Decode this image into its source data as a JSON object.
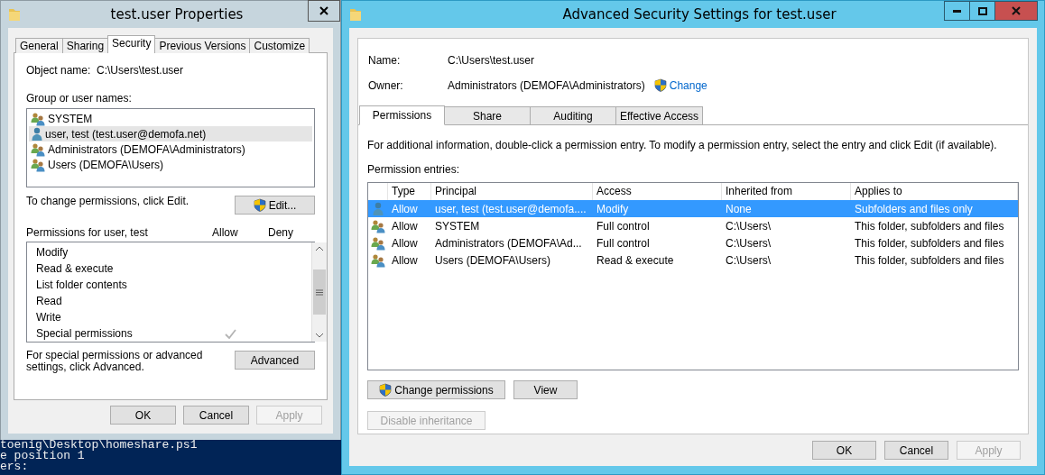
{
  "properties_window": {
    "title": "test.user Properties",
    "tabs": [
      {
        "label": "General",
        "selected": false
      },
      {
        "label": "Sharing",
        "selected": false
      },
      {
        "label": "Security",
        "selected": true
      },
      {
        "label": "Previous Versions",
        "selected": false
      },
      {
        "label": "Customize",
        "selected": false
      }
    ],
    "object_name_label": "Object name:",
    "object_name_value": "C:\\Users\\test.user",
    "groups_label": "Group or user names:",
    "groups": [
      {
        "kind": "group",
        "name": "SYSTEM",
        "selected": false
      },
      {
        "kind": "user",
        "name": "user, test (test.user@demofa.net)",
        "selected": true
      },
      {
        "kind": "group",
        "name": "Administrators (DEMOFA\\Administrators)",
        "selected": false
      },
      {
        "kind": "group",
        "name": "Users (DEMOFA\\Users)",
        "selected": false
      }
    ],
    "edit_hint": "To change permissions, click Edit.",
    "edit_button": "Edit...",
    "permissions_label": "Permissions for user, test",
    "allow_header": "Allow",
    "deny_header": "Deny",
    "permissions": [
      {
        "name": "Modify",
        "allow": false
      },
      {
        "name": "Read & execute",
        "allow": false
      },
      {
        "name": "List folder contents",
        "allow": false
      },
      {
        "name": "Read",
        "allow": false
      },
      {
        "name": "Write",
        "allow": false
      },
      {
        "name": "Special permissions",
        "allow": true
      }
    ],
    "advanced_hint": "For special permissions or advanced settings, click Advanced.",
    "advanced_button": "Advanced",
    "buttons": [
      {
        "label": "OK",
        "disabled": false
      },
      {
        "label": "Cancel",
        "disabled": false
      },
      {
        "label": "Apply",
        "disabled": true
      }
    ]
  },
  "console": {
    "lines": [
      "toenig\\Desktop\\homeshare.ps1",
      "e position 1",
      "ers:"
    ]
  },
  "advanced_window": {
    "title": "Advanced Security Settings for test.user",
    "name_label": "Name:",
    "name_value": "C:\\Users\\test.user",
    "owner_label": "Owner:",
    "owner_value": "Administrators (DEMOFA\\Administrators)",
    "change_link": "Change",
    "tabs": [
      {
        "label": "Permissions",
        "selected": true
      },
      {
        "label": "Share",
        "selected": false
      },
      {
        "label": "Auditing",
        "selected": false
      },
      {
        "label": "Effective Access",
        "selected": false
      }
    ],
    "info": "For additional information, double-click a permission entry. To modify a permission entry, select the entry and click Edit (if available).",
    "entries_label": "Permission entries:",
    "columns": [
      "Type",
      "Principal",
      "Access",
      "Inherited from",
      "Applies to"
    ],
    "rows": [
      {
        "kind": "user",
        "selected": true,
        "cells": [
          "Allow",
          "user, test (test.user@demofa....",
          "Modify",
          "None",
          "Subfolders and files only"
        ]
      },
      {
        "kind": "group",
        "selected": false,
        "cells": [
          "Allow",
          "SYSTEM",
          "Full control",
          "C:\\Users\\",
          "This folder, subfolders and files"
        ]
      },
      {
        "kind": "group",
        "selected": false,
        "cells": [
          "Allow",
          "Administrators (DEMOFA\\Ad...",
          "Full control",
          "C:\\Users\\",
          "This folder, subfolders and files"
        ]
      },
      {
        "kind": "group",
        "selected": false,
        "cells": [
          "Allow",
          "Users (DEMOFA\\Users)",
          "Read & execute",
          "C:\\Users\\",
          "This folder, subfolders and files"
        ]
      }
    ],
    "change_permissions_button": "Change permissions",
    "view_button": "View",
    "disable_inheritance": {
      "label": "Disable inheritance",
      "disabled": true
    },
    "buttons": [
      {
        "label": "OK",
        "disabled": false
      },
      {
        "label": "Cancel",
        "disabled": false
      },
      {
        "label": "Apply",
        "disabled": true
      }
    ]
  }
}
